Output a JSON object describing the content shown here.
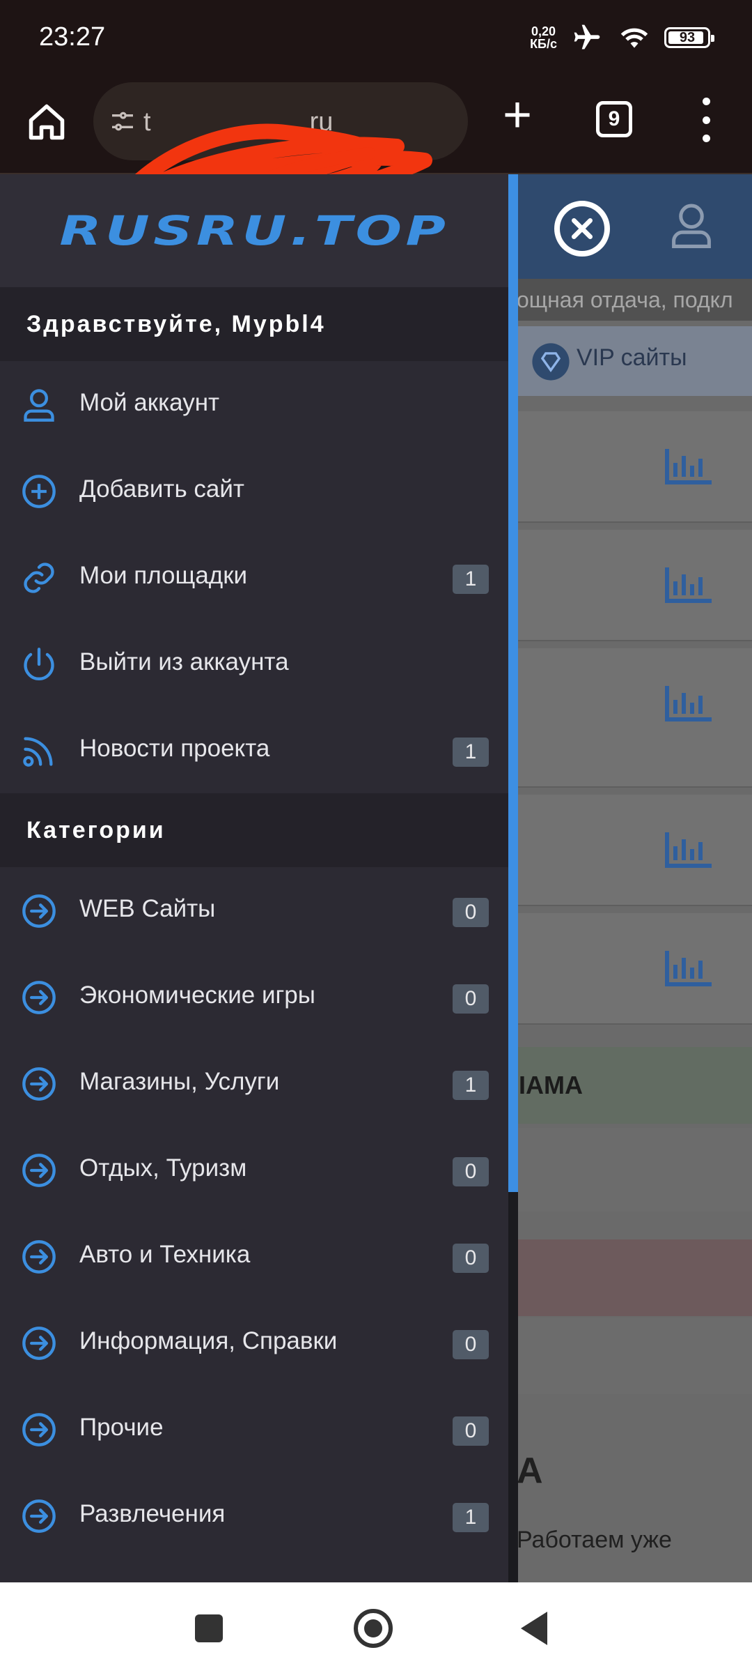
{
  "status_bar": {
    "time": "23:27",
    "net_speed_value": "0,20",
    "net_speed_unit": "КБ/с",
    "battery": "93",
    "battery_level": 0.93
  },
  "browser": {
    "url": "ru",
    "url_prefix": "t",
    "tab_count": "9"
  },
  "drawer": {
    "logo": "RUSRU.TOP",
    "greeting": "Здравствуйте, Mypbl4",
    "account_items": [
      {
        "label": "Мой аккаунт",
        "icon": "user-icon",
        "badge": ""
      },
      {
        "label": "Добавить сайт",
        "icon": "plus-circle-icon",
        "badge": ""
      },
      {
        "label": "Мои площадки",
        "icon": "link-icon",
        "badge": "1"
      },
      {
        "label": "Выйти из аккаунта",
        "icon": "power-icon",
        "badge": ""
      },
      {
        "label": "Новости проекта",
        "icon": "rss-icon",
        "badge": "1"
      }
    ],
    "categories_title": "Категории",
    "categories": [
      {
        "label": "WEB Сайты",
        "icon": "arrow-circle-right-icon",
        "badge": "0"
      },
      {
        "label": "Экономические игры",
        "icon": "arrow-circle-right-icon",
        "badge": "0"
      },
      {
        "label": "Магазины, Услуги",
        "icon": "arrow-circle-right-icon",
        "badge": "1"
      },
      {
        "label": "Отдых, Туризм",
        "icon": "arrow-circle-right-icon",
        "badge": "0"
      },
      {
        "label": "Авто и Техника",
        "icon": "arrow-circle-right-icon",
        "badge": "0"
      },
      {
        "label": "Информация, Справки",
        "icon": "arrow-circle-right-icon",
        "badge": "0"
      },
      {
        "label": "Прочие",
        "icon": "arrow-circle-right-icon",
        "badge": "0"
      },
      {
        "label": "Развлечения",
        "icon": "arrow-circle-right-icon",
        "badge": "1"
      }
    ]
  },
  "background_page": {
    "ticker": "ощная отдача, подкл",
    "vip": "VIP сайты",
    "ad_fragment": "IАМА",
    "big_fragment": "A",
    "work_fragment": "Работаем уже"
  },
  "colors": {
    "accent": "#3c8fe0",
    "drawer_bg": "#2c2a33",
    "section_bg": "#242229",
    "badge_bg": "#515b68"
  }
}
